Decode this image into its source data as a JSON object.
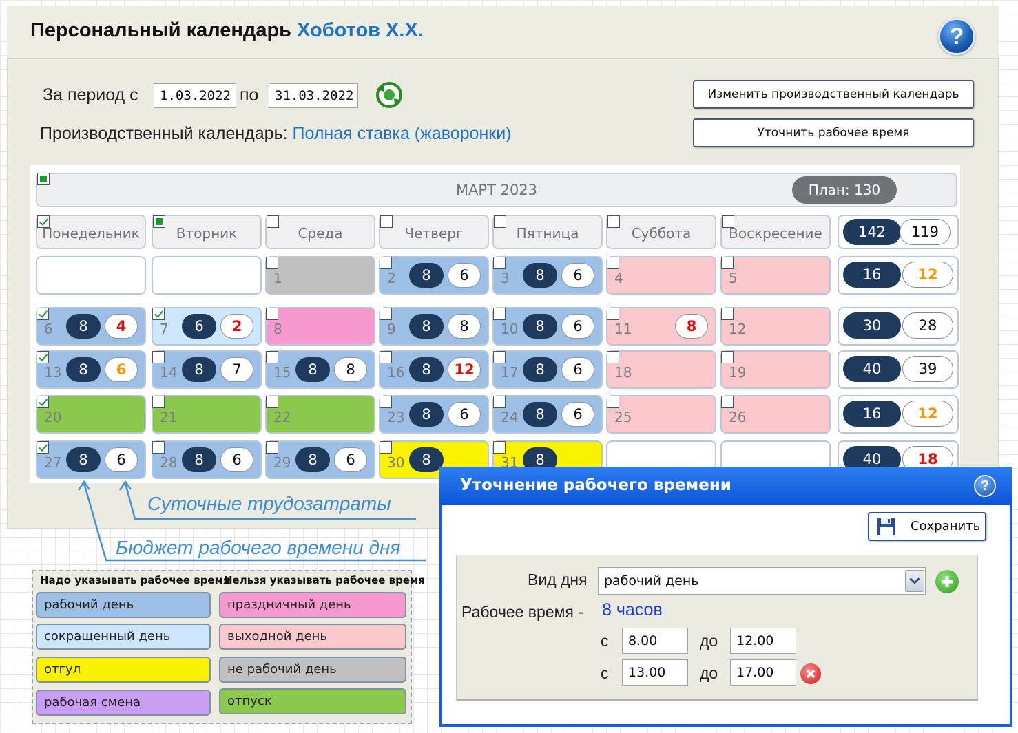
{
  "header": {
    "title": "Персональный календарь",
    "person": "Хоботов Х.Х."
  },
  "period": {
    "from_label": "За период с",
    "from_value": "1.03.2022",
    "to_label": "по",
    "to_value": "31.03.2022"
  },
  "production_calendar": {
    "label": "Производственный календарь:",
    "name": "Полная ставка (жаворонки)"
  },
  "buttons": {
    "change_calendar": "Изменить производственный календарь",
    "refine_time": "Уточнить рабочее время"
  },
  "calendar": {
    "month": "МАРТ 2023",
    "plan": "План: 130",
    "weekdays": [
      "Понедельник",
      "Вторник",
      "Среда",
      "Четверг",
      "Пятница",
      "Суббота",
      "Воскресение"
    ],
    "header_totals": {
      "budget": "142",
      "actual": "119"
    },
    "weeks": [
      {
        "days": [
          {
            "num": "",
            "type": "white",
            "budget": "",
            "actual": ""
          },
          {
            "num": "",
            "type": "white",
            "budget": "",
            "actual": ""
          },
          {
            "num": "1",
            "type": "grey",
            "budget": "",
            "actual": ""
          },
          {
            "num": "2",
            "type": "work",
            "budget": "8",
            "actual": "6"
          },
          {
            "num": "3",
            "type": "work",
            "budget": "8",
            "actual": "6"
          },
          {
            "num": "4",
            "type": "weekend",
            "budget": "",
            "actual": ""
          },
          {
            "num": "5",
            "type": "weekend",
            "budget": "",
            "actual": ""
          }
        ],
        "total_budget": "16",
        "total_actual": "12"
      },
      {
        "days": [
          {
            "num": "6",
            "type": "work",
            "budget": "8",
            "actual": "4"
          },
          {
            "num": "7",
            "type": "short",
            "budget": "6",
            "actual": "2"
          },
          {
            "num": "8",
            "type": "holiday",
            "budget": "",
            "actual": ""
          },
          {
            "num": "9",
            "type": "work",
            "budget": "8",
            "actual": "8"
          },
          {
            "num": "10",
            "type": "work",
            "budget": "8",
            "actual": "6"
          },
          {
            "num": "11",
            "type": "weekend",
            "budget": "",
            "actual": "8"
          },
          {
            "num": "12",
            "type": "weekend",
            "budget": "",
            "actual": ""
          }
        ],
        "total_budget": "30",
        "total_actual": "28"
      },
      {
        "days": [
          {
            "num": "13",
            "type": "work",
            "budget": "8",
            "actual": "6"
          },
          {
            "num": "14",
            "type": "work",
            "budget": "8",
            "actual": "7"
          },
          {
            "num": "15",
            "type": "work",
            "budget": "8",
            "actual": "8"
          },
          {
            "num": "16",
            "type": "work",
            "budget": "8",
            "actual": "12"
          },
          {
            "num": "17",
            "type": "work",
            "budget": "8",
            "actual": "6"
          },
          {
            "num": "18",
            "type": "weekend",
            "budget": "",
            "actual": ""
          },
          {
            "num": "19",
            "type": "weekend",
            "budget": "",
            "actual": ""
          }
        ],
        "total_budget": "40",
        "total_actual": "39"
      },
      {
        "days": [
          {
            "num": "20",
            "type": "leave",
            "budget": "",
            "actual": ""
          },
          {
            "num": "21",
            "type": "leave",
            "budget": "",
            "actual": ""
          },
          {
            "num": "22",
            "type": "leave",
            "budget": "",
            "actual": ""
          },
          {
            "num": "23",
            "type": "work",
            "budget": "8",
            "actual": "6"
          },
          {
            "num": "24",
            "type": "work",
            "budget": "8",
            "actual": "6"
          },
          {
            "num": "25",
            "type": "weekend",
            "budget": "",
            "actual": ""
          },
          {
            "num": "26",
            "type": "weekend",
            "budget": "",
            "actual": ""
          }
        ],
        "total_budget": "16",
        "total_actual": "12"
      },
      {
        "days": [
          {
            "num": "27",
            "type": "work",
            "budget": "8",
            "actual": "6"
          },
          {
            "num": "28",
            "type": "work",
            "budget": "8",
            "actual": "6"
          },
          {
            "num": "29",
            "type": "work",
            "budget": "8",
            "actual": "6"
          },
          {
            "num": "30",
            "type": "yellow",
            "budget": "8",
            "actual": ""
          },
          {
            "num": "31",
            "type": "yellow",
            "budget": "8",
            "actual": ""
          },
          {
            "num": "",
            "type": "white",
            "budget": "",
            "actual": ""
          },
          {
            "num": "",
            "type": "white",
            "budget": "",
            "actual": ""
          }
        ],
        "total_budget": "40",
        "total_actual": "18"
      }
    ]
  },
  "annotations": {
    "daily_effort": "Суточные трудозатраты",
    "day_budget": "Бюджет рабочего времени дня"
  },
  "legend": {
    "must_header": "Надо указывать рабочее время",
    "mustnot_header": "Нельзя указывать рабочее время",
    "must": [
      "рабочий день",
      "сокращенный день",
      "отгул",
      "рабочая смена"
    ],
    "mustnot": [
      "праздничный день",
      "выходной день",
      "не рабочий день",
      "отпуск"
    ]
  },
  "dialog": {
    "title": "Уточнение рабочего времени",
    "save": "Сохранить",
    "day_type_label": "Вид дня",
    "day_type_value": "рабочий день",
    "work_time_label": "Рабочее время -",
    "work_time_value": "8 часов",
    "from_label": "с",
    "to_label": "до",
    "interval1_from": "8.00",
    "interval1_to": "12.00",
    "interval2_from": "13.00",
    "interval2_to": "17.00"
  },
  "colors": {
    "work": "#9dbfe6",
    "short": "#cde6fb",
    "holiday": "#f699cf",
    "weekend": "#fbc9cb",
    "grey": "#c0c0c0",
    "leave": "#8cc84e",
    "yellow": "#fbf200",
    "shift": "#c79ef2",
    "accent": "#1f73c2",
    "dialog": "#1a5ed8"
  }
}
